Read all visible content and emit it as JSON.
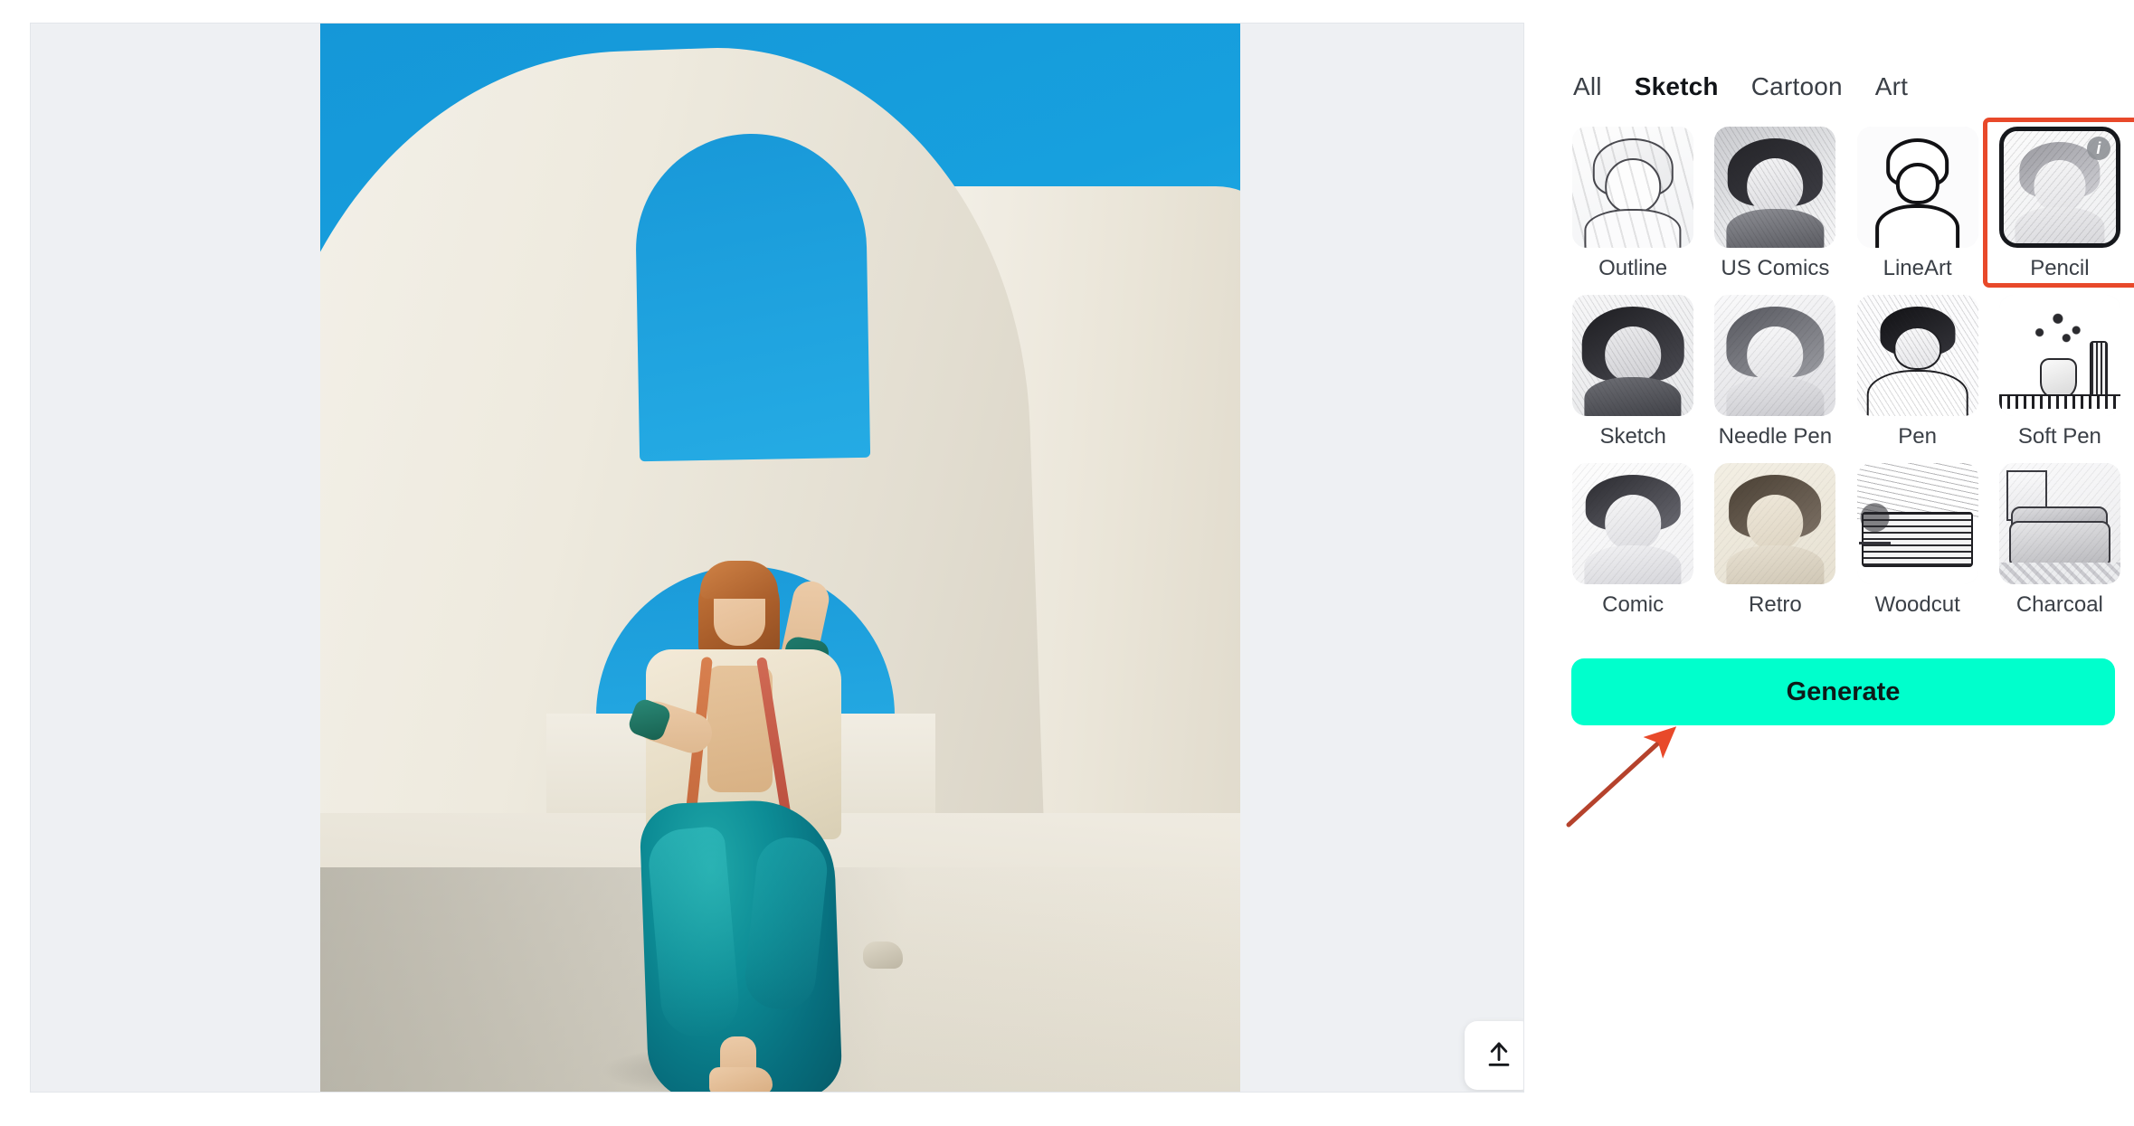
{
  "window": {
    "close_icon": "close-icon"
  },
  "canvas": {
    "name": "image-preview-canvas",
    "upload_icon": "upload-icon",
    "photo": {
      "alt": "Woman in teal skirt and cream jacket walking under white Mediterranean arches against blue sky"
    }
  },
  "side_panel": {
    "tabs": [
      {
        "label": "All",
        "active": false
      },
      {
        "label": "Sketch",
        "active": true
      },
      {
        "label": "Cartoon",
        "active": false
      },
      {
        "label": "Art",
        "active": false
      }
    ],
    "styles": [
      {
        "label": "Outline",
        "selected": false,
        "info_badge": null
      },
      {
        "label": "US Comics",
        "selected": false,
        "info_badge": null
      },
      {
        "label": "LineArt",
        "selected": false,
        "info_badge": null
      },
      {
        "label": "Pencil",
        "selected": true,
        "info_badge": "i"
      },
      {
        "label": "Sketch",
        "selected": false,
        "info_badge": null
      },
      {
        "label": "Needle Pen",
        "selected": false,
        "info_badge": null
      },
      {
        "label": "Pen",
        "selected": false,
        "info_badge": null
      },
      {
        "label": "Soft Pen",
        "selected": false,
        "info_badge": null
      },
      {
        "label": "Comic",
        "selected": false,
        "info_badge": null
      },
      {
        "label": "Retro",
        "selected": false,
        "info_badge": null
      },
      {
        "label": "Woodcut",
        "selected": false,
        "info_badge": null
      },
      {
        "label": "Charcoal",
        "selected": false,
        "info_badge": null
      }
    ],
    "generate_label": "Generate"
  },
  "colors": {
    "generate_button": "#00ffcc",
    "annotation_red": "#e8492a",
    "selected_border": "#16181c",
    "panel_background": "#ffffff",
    "canvas_background": "#eef0f3",
    "sky_blue": "#1ea1dd",
    "skirt_teal": "#0d8d96"
  },
  "annotations": {
    "highlight_target": "Pencil",
    "arrow_target": "Generate"
  }
}
